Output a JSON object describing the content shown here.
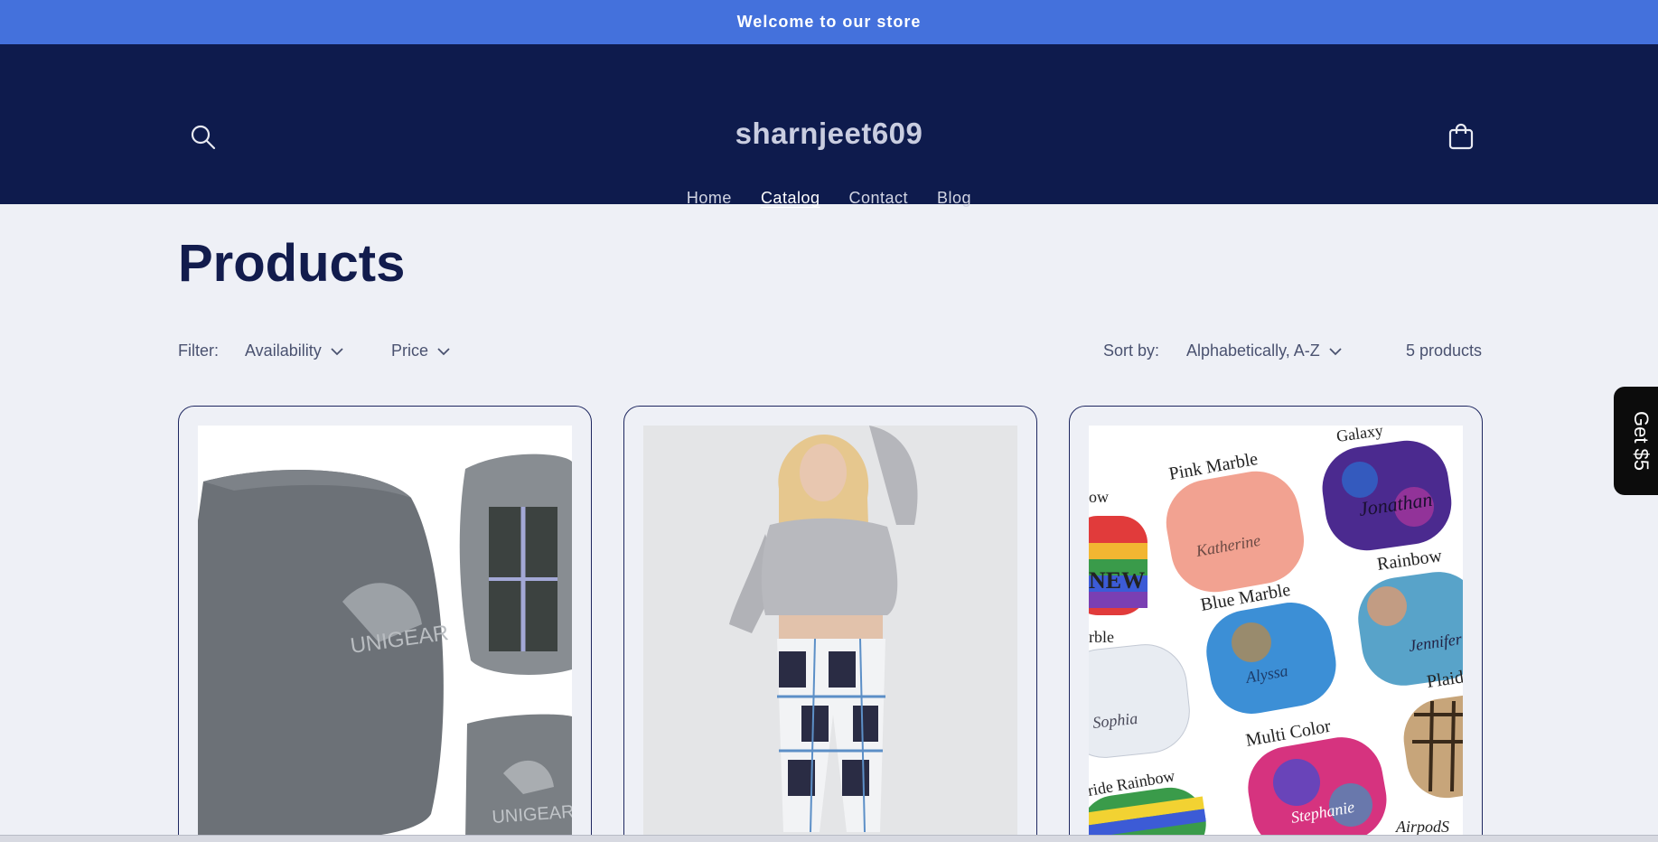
{
  "announcement": "Welcome to our store",
  "header": {
    "brand": "sharnjeet609",
    "nav": [
      "Home",
      "Catalog",
      "Contact",
      "Blog"
    ],
    "active_nav": "Catalog"
  },
  "main": {
    "title": "Products",
    "filter_label": "Filter:",
    "filters": [
      "Availability",
      "Price"
    ],
    "sort_label": "Sort by:",
    "sort_value": "Alphabetically, A-Z",
    "product_count": "5 products"
  },
  "products": [
    {
      "image": "rain-cover-backpack-image",
      "image_texts": [
        "UNIGEAR",
        "UNIGEAR"
      ]
    },
    {
      "image": "plaid-pants-model-image"
    },
    {
      "image": "airpods-case-image",
      "image_texts": [
        "Galaxy",
        "Pink Marble",
        "Rainbow",
        "Blue Marble",
        "Multi Color",
        "Plaid",
        "Jonathan",
        "Katherine",
        "Jennifer",
        "Alyssa",
        "Sophia",
        "Stephanie",
        "ow",
        "rble",
        "ride Rainbow",
        "NEW",
        "AirpodS"
      ]
    }
  ],
  "side_tab": "Get $5",
  "colors": {
    "announcement_bg": "#4471dc",
    "header_bg": "#0e1b4d",
    "page_bg": "#eef0f6",
    "title": "#121c4d"
  }
}
